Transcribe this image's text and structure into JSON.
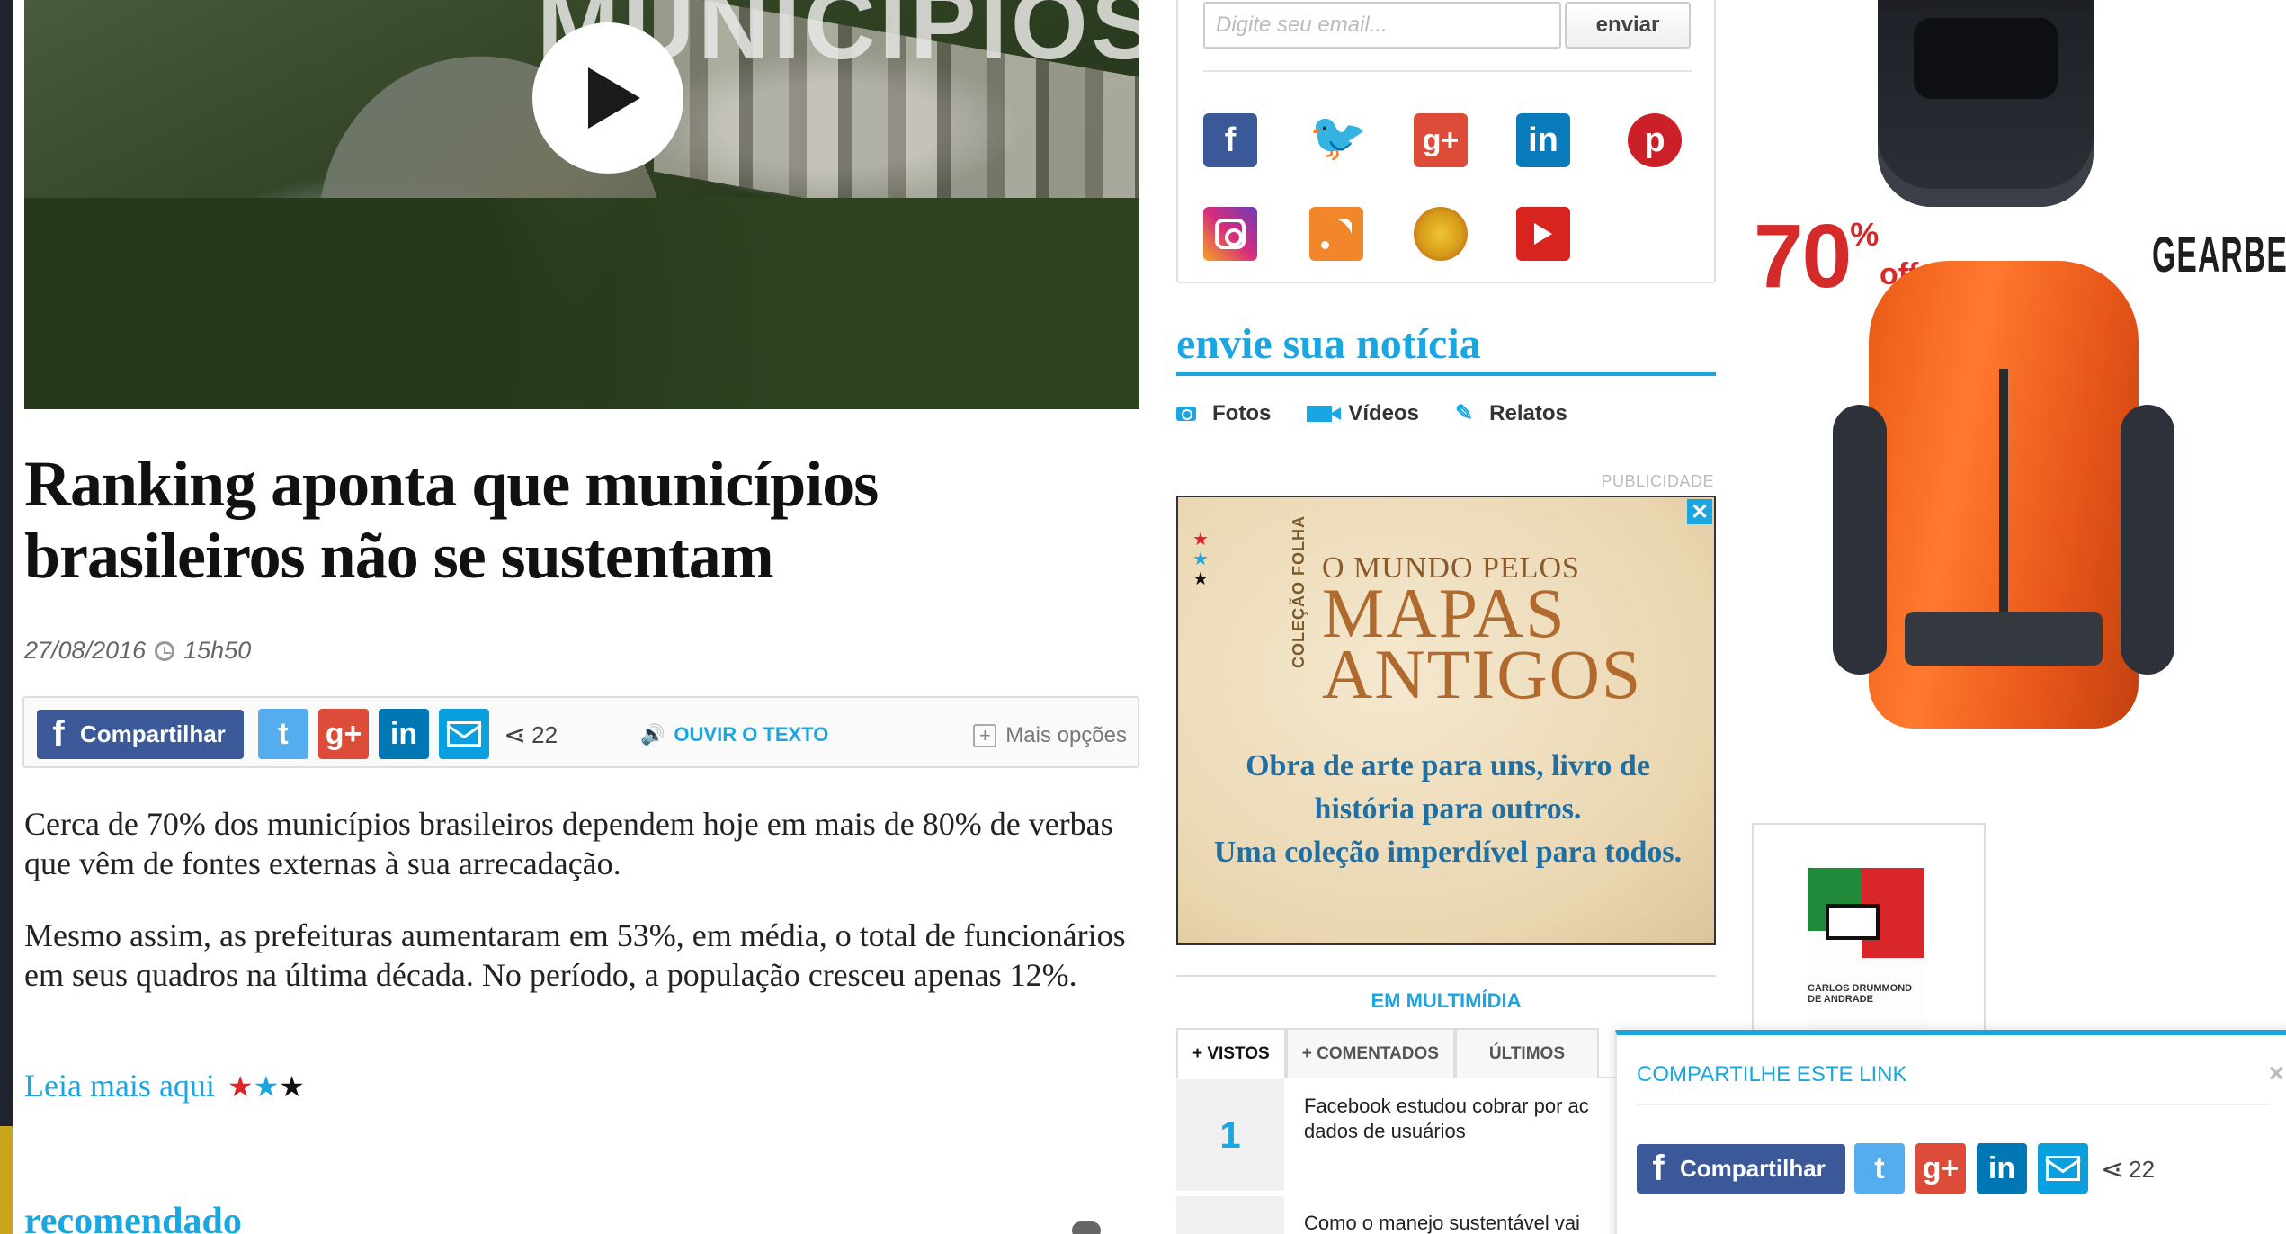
{
  "video": {
    "caption_fragment": "MUNICÍPIOS"
  },
  "article": {
    "headline": "Ranking aponta que municípios brasileiros não se sustentam",
    "date": "27/08/2016",
    "time": "15h50",
    "paragraphs": [
      "Cerca de 70% dos municípios brasileiros dependem hoje em mais de 80% de verbas que vêm de fontes externas à sua arrecadação.",
      "Mesmo assim, as prefeituras aumentaram em 53%, em média, o total de funcionários em seus quadros na última década. No período, a população cresceu apenas 12%."
    ],
    "read_more": "Leia mais aqui",
    "recommended_heading": "recomendado"
  },
  "share": {
    "facebook_label": "Compartilhar",
    "count": "22",
    "listen_label": "OUVIR O TEXTO",
    "more_label": "Mais opções",
    "twitter_glyph": "t",
    "gplus_glyph": "g+",
    "linkedin_glyph": "in"
  },
  "newsletter": {
    "email_placeholder": "Digite seu email...",
    "send_label": "enviar"
  },
  "social_icons": [
    "facebook-icon",
    "twitter-icon",
    "google-plus-icon",
    "linkedin-icon",
    "pinterest-icon",
    "instagram-icon",
    "rss-icon",
    "radio-icon",
    "youtube-icon"
  ],
  "submit_news": {
    "title": "envie sua notícia",
    "links": [
      "Fotos",
      "Vídeos",
      "Relatos"
    ]
  },
  "ads": {
    "label": "PUBLICIDADE",
    "close": "✕",
    "maps": {
      "series": "COLEÇÃO FOLHA",
      "line1": "O MUNDO PELOS",
      "line2": "MAPAS",
      "line3": "ANTIGOS",
      "tagline1": "Obra de arte para uns, livro de",
      "tagline2": "história para outros.",
      "tagline3": "Uma coleção imperdível para todos."
    },
    "gearbest": {
      "percent": "70",
      "percent_sign": "%",
      "off": "off",
      "brand": "GEARBEST"
    },
    "book": {
      "author_line1": "CARLOS DRUMMOND",
      "author_line2": "DE ANDRADE"
    }
  },
  "multimedia": {
    "title": "EM MULTIMÍDIA",
    "tabs": [
      "+ VISTOS",
      "+ COMENTADOS",
      "ÚLTIMOS"
    ],
    "items": [
      {
        "rank": "1",
        "line1": "Facebook estudou cobrar por ac",
        "line2": "dados de usuários"
      },
      {
        "rank": "",
        "line1": "Como o manejo sustentável vai",
        "line2": ""
      }
    ]
  },
  "share_popup": {
    "title": "COMPARTILHE ESTE LINK",
    "close": "×",
    "facebook_label": "Compartilhar",
    "count": "22"
  },
  "colors": {
    "accent": "#1aa6e0",
    "facebook": "#3b5998",
    "twitter": "#55acee",
    "gplus": "#dd4b39",
    "linkedin": "#0077b5",
    "star_red": "#e0242a",
    "star_blue": "#1aa6e0",
    "star_black": "#111111"
  }
}
